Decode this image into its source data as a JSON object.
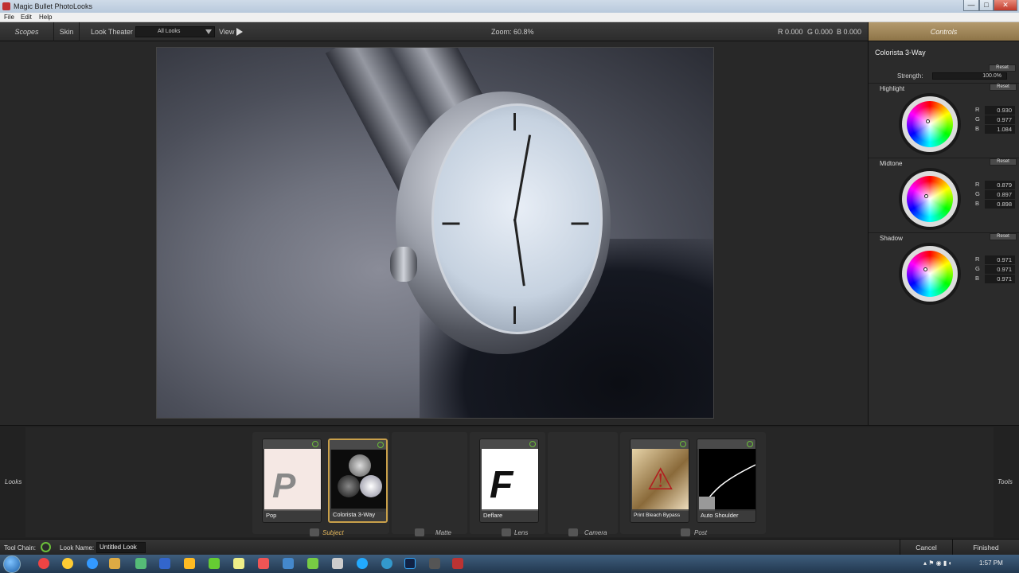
{
  "window": {
    "title": "Magic Bullet PhotoLooks",
    "minimize": "—",
    "maximize": "□",
    "close": "✕"
  },
  "menu": [
    "File",
    "Edit",
    "Help"
  ],
  "toolbar": {
    "scopes": "Scopes",
    "skin": "Skin",
    "look_theater": "Look Theater",
    "looks_dropdown": "All Looks",
    "view": "View",
    "zoom": "Zoom:  60.8%",
    "r": "R 0.000",
    "g": "G 0.000",
    "b": "B 0.000"
  },
  "controls": {
    "header": "Controls",
    "tool_name": "Colorista 3-Way",
    "reset_label": "Reset",
    "strength_label": "Strength:",
    "strength_value": "100.0%",
    "wheels": [
      {
        "label": "Highlight",
        "r": "0.930",
        "g": "0.977",
        "b": "1.084"
      },
      {
        "label": "Midtone",
        "r": "0.879",
        "g": "0.897",
        "b": "0.898"
      },
      {
        "label": "Shadow",
        "r": "0.971",
        "g": "0.971",
        "b": "0.971"
      }
    ],
    "r_key": "R",
    "g_key": "G",
    "b_key": "B"
  },
  "tray": {
    "looks_label": "Looks",
    "tools_label": "Tools",
    "sections": [
      "Subject",
      "Matte",
      "Lens",
      "Camera",
      "Post"
    ],
    "cards": [
      {
        "name": "Pop",
        "letter": "P"
      },
      {
        "name": "Colorista 3-Way",
        "letter": ""
      },
      {
        "name": "Deflare",
        "letter": "F"
      },
      {
        "name": "Print Bleach Bypass",
        "letter": ""
      },
      {
        "name": "Auto Shoulder",
        "letter": ""
      }
    ]
  },
  "statusbar": {
    "tool_chain": "Tool Chain:",
    "look_name_label": "Look Name:",
    "look_name": "Untitled Look",
    "cancel": "Cancel",
    "finished": "Finished"
  },
  "taskbar": {
    "time": "1:57 PM"
  }
}
